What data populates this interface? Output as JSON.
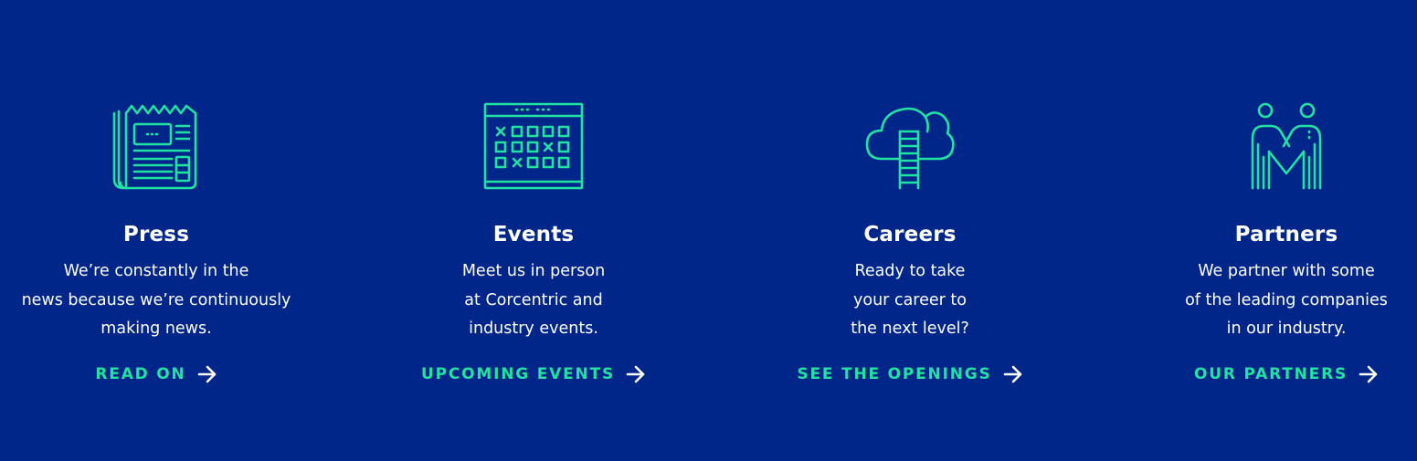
{
  "theme": {
    "background": "#00268a",
    "accent": "#22e2a1",
    "text": "#ffffff"
  },
  "cards": [
    {
      "title": "Press",
      "icon": "newspaper-icon",
      "desc_lines": [
        "We’re constantly in the",
        "news because we’re continuously",
        "making news."
      ],
      "cta": "READ ON"
    },
    {
      "title": "Events",
      "icon": "calendar-icon",
      "desc_lines": [
        "Meet us in person",
        "at Corcentric and",
        "industry events."
      ],
      "cta": "UPCOMING EVENTS"
    },
    {
      "title": "Careers",
      "icon": "cloud-ladder-icon",
      "desc_lines": [
        "Ready to take",
        "your career to",
        "the next level?"
      ],
      "cta": "SEE THE OPENINGS"
    },
    {
      "title": "Partners",
      "icon": "handshake-people-icon",
      "desc_lines": [
        "We partner with some",
        "of the leading companies",
        "in our industry."
      ],
      "cta": "OUR PARTNERS"
    }
  ]
}
